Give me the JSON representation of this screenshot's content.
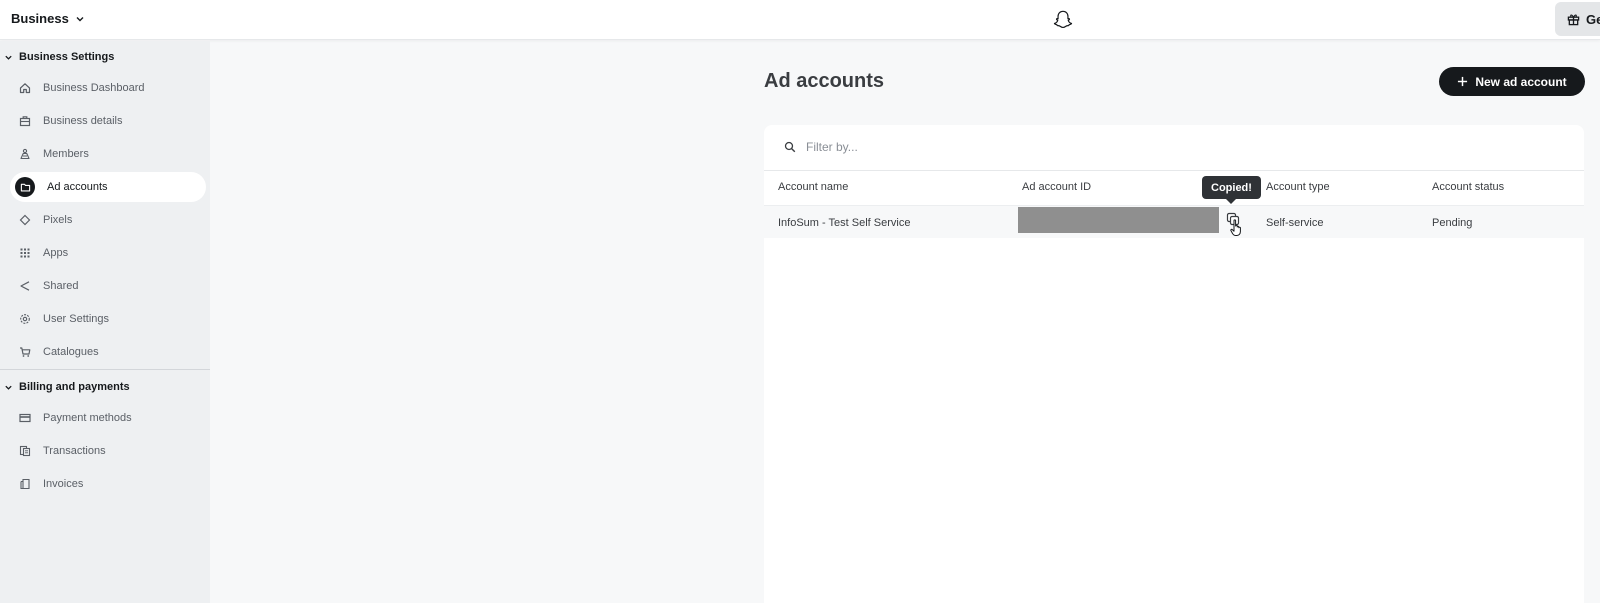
{
  "topbar": {
    "business_label": "Business",
    "gift_button_label": "Ge"
  },
  "sidebar": {
    "section_business": "Business Settings",
    "items": [
      {
        "label": "Business Dashboard",
        "icon": "home-icon"
      },
      {
        "label": "Business details",
        "icon": "briefcase-icon"
      },
      {
        "label": "Members",
        "icon": "members-icon"
      },
      {
        "label": "Ad accounts",
        "icon": "folder-icon",
        "active": true
      },
      {
        "label": "Pixels",
        "icon": "diamond-icon"
      },
      {
        "label": "Apps",
        "icon": "grid-icon"
      },
      {
        "label": "Shared",
        "icon": "share-icon"
      },
      {
        "label": "User Settings",
        "icon": "gear-icon"
      },
      {
        "label": "Catalogues",
        "icon": "cart-icon"
      }
    ],
    "section_billing": "Billing and payments",
    "billing_items": [
      {
        "label": "Payment methods",
        "icon": "card-icon"
      },
      {
        "label": "Transactions",
        "icon": "transactions-icon"
      },
      {
        "label": "Invoices",
        "icon": "invoice-icon"
      }
    ]
  },
  "main": {
    "title": "Ad accounts",
    "new_button_label": "New ad account",
    "filter_placeholder": "Filter by...",
    "columns": [
      "Account name",
      "Ad account ID",
      "Account type",
      "Account status"
    ],
    "rows": [
      {
        "account_name": "InfoSum - Test Self Service",
        "account_id": "",
        "account_type": "Self-service",
        "account_status": "Pending"
      }
    ],
    "tooltip": "Copied!"
  }
}
